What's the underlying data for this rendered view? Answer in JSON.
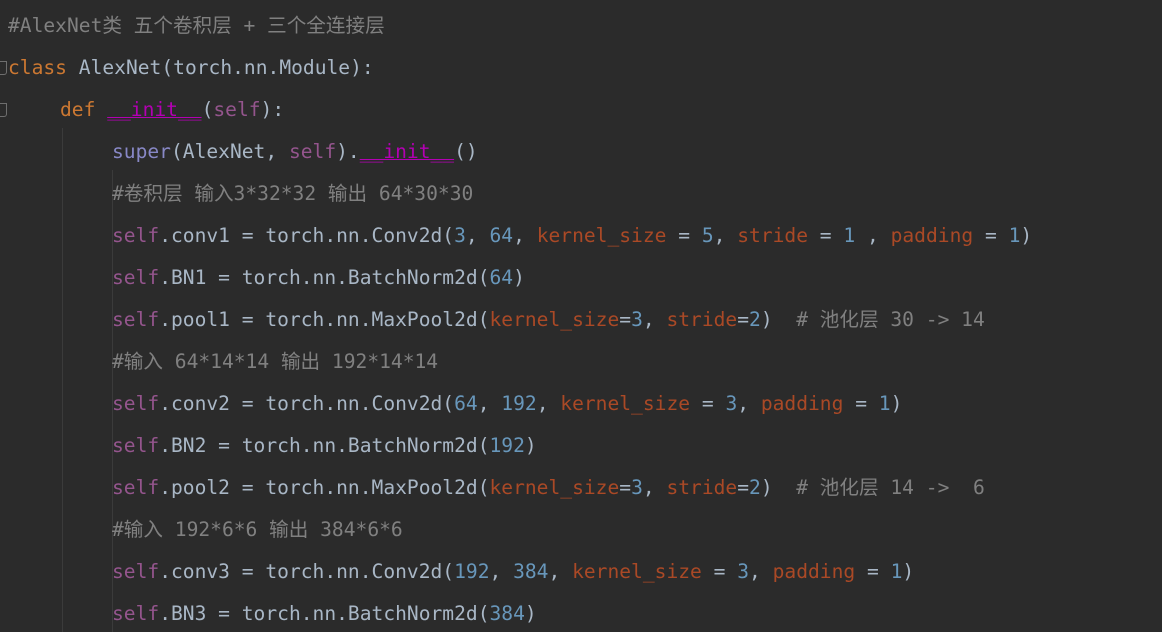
{
  "editor": {
    "colors": {
      "background": "#2b2b2b",
      "comment": "#808080",
      "keyword": "#cc7832",
      "self": "#94558d",
      "magic": "#b200b2",
      "number": "#6897bb",
      "keyword_argument": "#aa4926",
      "plain": "#a9b7c6",
      "builtin": "#8888c6"
    },
    "lines": [
      {
        "tokens": [
          {
            "t": "#AlexNet类 五个卷积层 + 三个全连接层",
            "c": "comment"
          }
        ]
      },
      {
        "tokens": [
          {
            "t": "class",
            "c": "keyword"
          },
          {
            "t": " AlexNet(torch.nn.Module):",
            "c": "plain"
          }
        ]
      },
      {
        "tokens": [
          {
            "t": "def",
            "c": "keyword"
          },
          {
            "t": " ",
            "c": "plain"
          },
          {
            "t": "__init__",
            "c": "magic"
          },
          {
            "t": "(",
            "c": "plain"
          },
          {
            "t": "self",
            "c": "self"
          },
          {
            "t": "):",
            "c": "plain"
          }
        ]
      },
      {
        "tokens": [
          {
            "t": "super",
            "c": "builtin"
          },
          {
            "t": "(AlexNet, ",
            "c": "plain"
          },
          {
            "t": "self",
            "c": "self"
          },
          {
            "t": ").",
            "c": "plain"
          },
          {
            "t": "__init__",
            "c": "magic"
          },
          {
            "t": "()",
            "c": "plain"
          }
        ]
      },
      {
        "tokens": [
          {
            "t": "#卷积层 输入3*32*32 输出 64*30*30",
            "c": "comment"
          }
        ]
      },
      {
        "tokens": [
          {
            "t": "self",
            "c": "self"
          },
          {
            "t": ".conv1 = torch.nn.Conv2d(",
            "c": "plain"
          },
          {
            "t": "3",
            "c": "num"
          },
          {
            "t": ", ",
            "c": "plain"
          },
          {
            "t": "64",
            "c": "num"
          },
          {
            "t": ", ",
            "c": "plain"
          },
          {
            "t": "kernel_size",
            "c": "param"
          },
          {
            "t": " = ",
            "c": "plain"
          },
          {
            "t": "5",
            "c": "num"
          },
          {
            "t": ", ",
            "c": "plain"
          },
          {
            "t": "stride",
            "c": "param"
          },
          {
            "t": " = ",
            "c": "plain"
          },
          {
            "t": "1",
            "c": "num"
          },
          {
            "t": " , ",
            "c": "plain"
          },
          {
            "t": "padding",
            "c": "param"
          },
          {
            "t": " = ",
            "c": "plain"
          },
          {
            "t": "1",
            "c": "num"
          },
          {
            "t": ")",
            "c": "plain"
          }
        ]
      },
      {
        "tokens": [
          {
            "t": "self",
            "c": "self"
          },
          {
            "t": ".BN1 = torch.nn.BatchNorm2d(",
            "c": "plain"
          },
          {
            "t": "64",
            "c": "num"
          },
          {
            "t": ")",
            "c": "plain"
          }
        ]
      },
      {
        "tokens": [
          {
            "t": "self",
            "c": "self"
          },
          {
            "t": ".pool1 = torch.nn.MaxPool2d(",
            "c": "plain"
          },
          {
            "t": "kernel_size",
            "c": "param"
          },
          {
            "t": "=",
            "c": "plain"
          },
          {
            "t": "3",
            "c": "num"
          },
          {
            "t": ", ",
            "c": "plain"
          },
          {
            "t": "stride",
            "c": "param"
          },
          {
            "t": "=",
            "c": "plain"
          },
          {
            "t": "2",
            "c": "num"
          },
          {
            "t": ")  ",
            "c": "plain"
          },
          {
            "t": "# 池化层 30 -> 14",
            "c": "comment"
          }
        ]
      },
      {
        "tokens": [
          {
            "t": "#输入 64*14*14 输出 192*14*14",
            "c": "comment"
          }
        ]
      },
      {
        "tokens": [
          {
            "t": "self",
            "c": "self"
          },
          {
            "t": ".conv2 = torch.nn.Conv2d(",
            "c": "plain"
          },
          {
            "t": "64",
            "c": "num"
          },
          {
            "t": ", ",
            "c": "plain"
          },
          {
            "t": "192",
            "c": "num"
          },
          {
            "t": ", ",
            "c": "plain"
          },
          {
            "t": "kernel_size",
            "c": "param"
          },
          {
            "t": " = ",
            "c": "plain"
          },
          {
            "t": "3",
            "c": "num"
          },
          {
            "t": ", ",
            "c": "plain"
          },
          {
            "t": "padding",
            "c": "param"
          },
          {
            "t": " = ",
            "c": "plain"
          },
          {
            "t": "1",
            "c": "num"
          },
          {
            "t": ")",
            "c": "plain"
          }
        ]
      },
      {
        "tokens": [
          {
            "t": "self",
            "c": "self"
          },
          {
            "t": ".BN2 = torch.nn.BatchNorm2d(",
            "c": "plain"
          },
          {
            "t": "192",
            "c": "num"
          },
          {
            "t": ")",
            "c": "plain"
          }
        ]
      },
      {
        "tokens": [
          {
            "t": "self",
            "c": "self"
          },
          {
            "t": ".pool2 = torch.nn.MaxPool2d(",
            "c": "plain"
          },
          {
            "t": "kernel_size",
            "c": "param"
          },
          {
            "t": "=",
            "c": "plain"
          },
          {
            "t": "3",
            "c": "num"
          },
          {
            "t": ", ",
            "c": "plain"
          },
          {
            "t": "stride",
            "c": "param"
          },
          {
            "t": "=",
            "c": "plain"
          },
          {
            "t": "2",
            "c": "num"
          },
          {
            "t": ")  ",
            "c": "plain"
          },
          {
            "t": "# 池化层 14 ->  6",
            "c": "comment"
          }
        ]
      },
      {
        "tokens": [
          {
            "t": "#输入 192*6*6 输出 384*6*6",
            "c": "comment"
          }
        ]
      },
      {
        "tokens": [
          {
            "t": "self",
            "c": "self"
          },
          {
            "t": ".conv3 = torch.nn.Conv2d(",
            "c": "plain"
          },
          {
            "t": "192",
            "c": "num"
          },
          {
            "t": ", ",
            "c": "plain"
          },
          {
            "t": "384",
            "c": "num"
          },
          {
            "t": ", ",
            "c": "plain"
          },
          {
            "t": "kernel_size",
            "c": "param"
          },
          {
            "t": " = ",
            "c": "plain"
          },
          {
            "t": "3",
            "c": "num"
          },
          {
            "t": ", ",
            "c": "plain"
          },
          {
            "t": "padding",
            "c": "param"
          },
          {
            "t": " = ",
            "c": "plain"
          },
          {
            "t": "1",
            "c": "num"
          },
          {
            "t": ")",
            "c": "plain"
          }
        ]
      },
      {
        "tokens": [
          {
            "t": "self",
            "c": "self"
          },
          {
            "t": ".BN3 = torch.nn.BatchNorm2d(",
            "c": "plain"
          },
          {
            "t": "384",
            "c": "num"
          },
          {
            "t": ")",
            "c": "plain"
          }
        ]
      }
    ]
  }
}
